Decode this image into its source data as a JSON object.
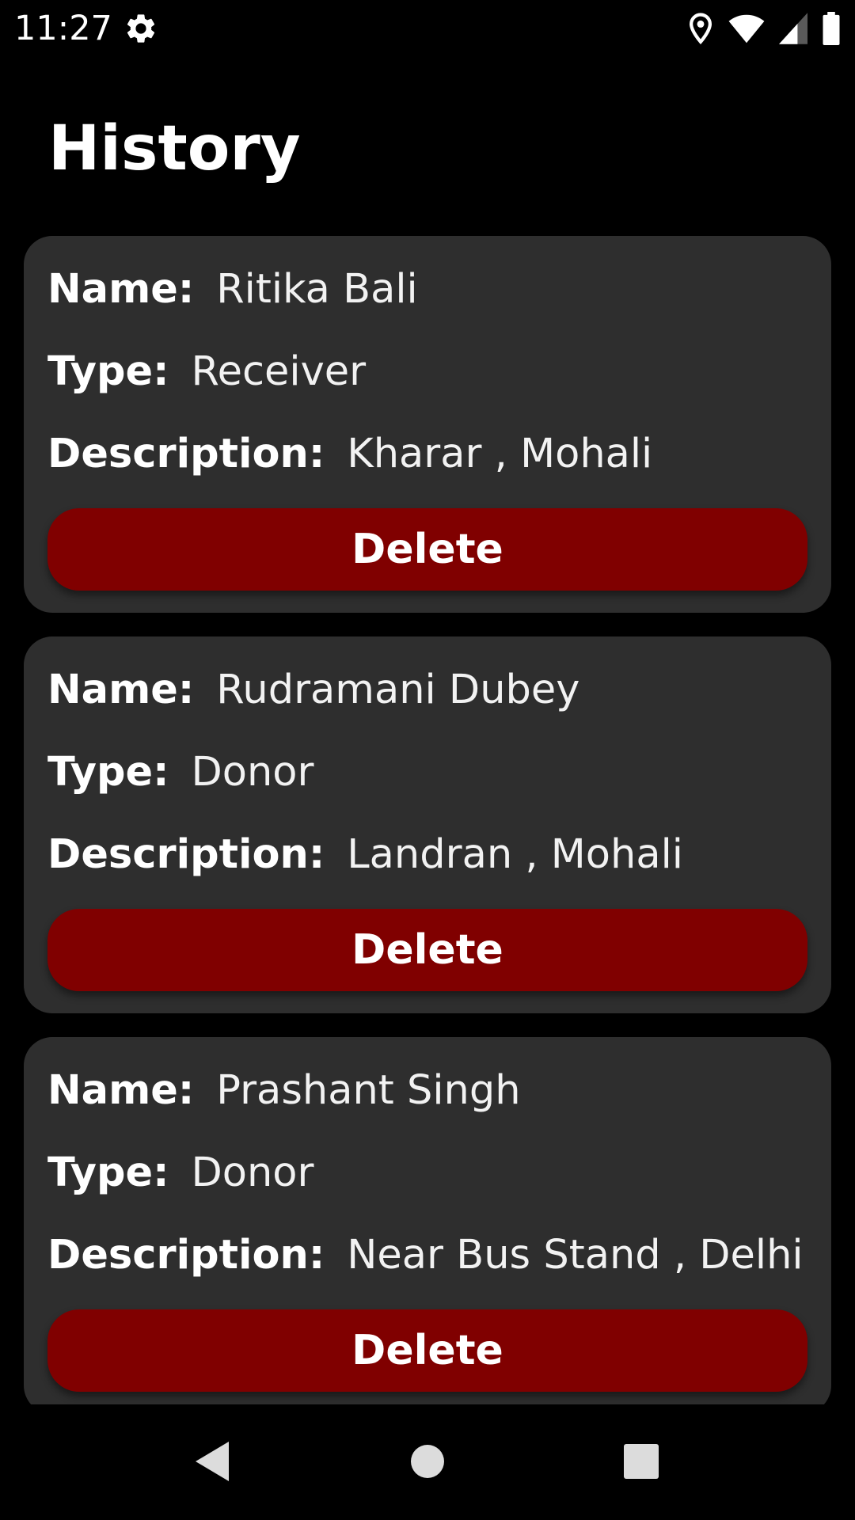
{
  "status_bar": {
    "time": "11:27",
    "icons": [
      "settings-gear-icon",
      "location-icon",
      "wifi-icon",
      "cell-signal-icon",
      "battery-icon"
    ]
  },
  "page": {
    "title": "History"
  },
  "labels": {
    "name": "Name:",
    "type": "Type:",
    "description": "Description:",
    "delete": "Delete"
  },
  "records": [
    {
      "name": "Ritika Bali",
      "type": "Receiver",
      "description": "Kharar , Mohali"
    },
    {
      "name": "Rudramani Dubey",
      "type": "Donor",
      "description": "Landran , Mohali"
    },
    {
      "name": "Prashant Singh",
      "type": "Donor",
      "description": "Near Bus Stand , Delhi"
    }
  ],
  "navigation": {
    "icons": [
      "back-icon",
      "home-icon",
      "recents-icon"
    ]
  },
  "colors": {
    "background": "#000000",
    "card": "#2e2e2e",
    "delete_button": "#800000",
    "text": "#ffffff"
  }
}
